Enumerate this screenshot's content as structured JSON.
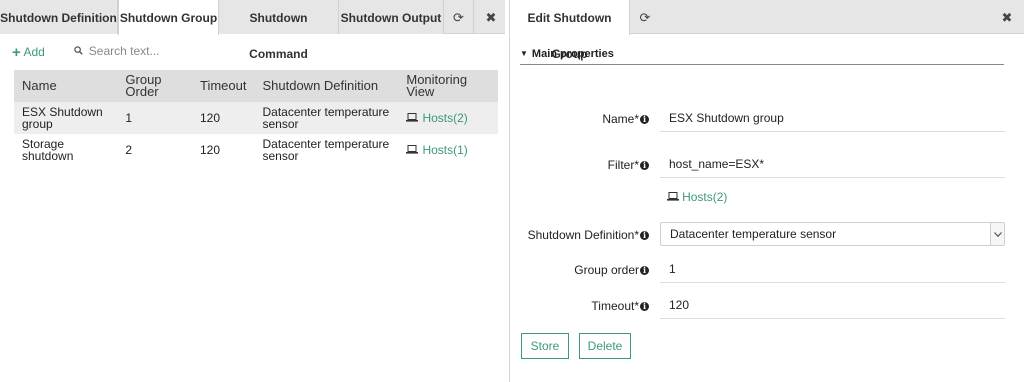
{
  "left_tabs": [
    {
      "label": "Shutdown Definition"
    },
    {
      "label": "Shutdown Group"
    },
    {
      "label": "Shutdown Command"
    },
    {
      "label": "Shutdown Output"
    }
  ],
  "icons": {
    "refresh": "⟳",
    "close": "✖",
    "add_plus": "+",
    "search": "🔍",
    "laptop": "💻",
    "triangle_down": "▼",
    "caret_down": "⌄",
    "info": "i"
  },
  "toolbar": {
    "add_label": "Add",
    "search_placeholder": "Search text..."
  },
  "table": {
    "headers": [
      "Name",
      "Group Order",
      "Timeout",
      "Shutdown Definition",
      "Monitoring View"
    ],
    "rows": [
      {
        "name": "ESX Shutdown group",
        "order": "1",
        "timeout": "120",
        "definition": "Datacenter temperature sensor",
        "view": "Hosts(2)"
      },
      {
        "name": "Storage shutdown",
        "order": "2",
        "timeout": "120",
        "definition": "Datacenter temperature sensor",
        "view": "Hosts(1)"
      }
    ]
  },
  "right_tab": {
    "label": "Edit Shutdown Group"
  },
  "form": {
    "section_title": "Main properties",
    "name_label": "Name*",
    "name_value": "ESX Shutdown group",
    "filter_label": "Filter*",
    "filter_value": "host_name=ESX*",
    "filter_link": "Hosts(2)",
    "definition_label": "Shutdown Definition*",
    "definition_value": "Datacenter temperature sensor",
    "order_label": "Group order",
    "order_value": "1",
    "timeout_label": "Timeout*",
    "timeout_value": "120",
    "store_label": "Store",
    "delete_label": "Delete"
  },
  "colors": {
    "accent": "#3d9978",
    "tabbar": "#e6e6e6",
    "header_row": "#dedede",
    "selected_row": "#eeeeee"
  }
}
